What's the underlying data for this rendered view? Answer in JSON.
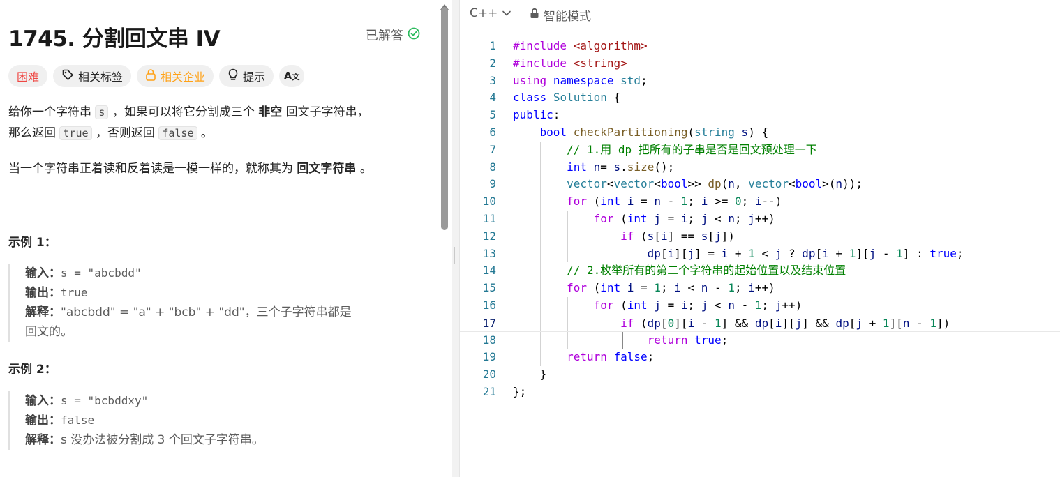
{
  "problem": {
    "title": "1745. 分割回文串 IV",
    "solved_label": "已解答",
    "tags": {
      "difficulty": "困难",
      "related_tags": "相关标签",
      "related_companies": "相关企业",
      "hint": "提示",
      "translate_icon": "translate-icon"
    },
    "desc1_a": "给你一个字符串",
    "desc1_s": "s",
    "desc1_b": "，如果可以将它分割成三个",
    "desc1_bold": "非空",
    "desc1_c": "回文子字符串，",
    "desc2_a": "那么返回",
    "desc2_true": "true",
    "desc2_b": "，否则返回",
    "desc2_false": "false",
    "desc2_c": "。",
    "desc3_a": "当一个字符串正着读和反着读是一模一样的，就称其为",
    "desc3_bold": "回文字符串",
    "desc3_c": "。",
    "examples": [
      {
        "title": "示例 1：",
        "input_label": "输入：",
        "input": "s = \"abcbdd\"",
        "output_label": "输出：",
        "output": "true",
        "explain_label": "解释：",
        "explain": "\"abcbdd\" = \"a\" + \"bcb\" + \"dd\"，三个子字符串都是",
        "explain2": "回文的。"
      },
      {
        "title": "示例 2：",
        "input_label": "输入：",
        "input": "s = \"bcbddxy\"",
        "output_label": "输出：",
        "output": "false",
        "explain_label": "解释：",
        "explain": "s 没办法被分割成 3 个回文子字符串。"
      }
    ]
  },
  "editor": {
    "language": "C++",
    "mode": "智能模式",
    "current_line": 17,
    "line_numbers": [
      "1",
      "2",
      "3",
      "4",
      "5",
      "6",
      "7",
      "8",
      "9",
      "10",
      "11",
      "12",
      "13",
      "14",
      "15",
      "16",
      "17",
      "18",
      "19",
      "20",
      "21"
    ]
  },
  "colors": {
    "hard": "#ef4743",
    "company": "#ffa116",
    "solved_check": "#2cbb5d"
  }
}
